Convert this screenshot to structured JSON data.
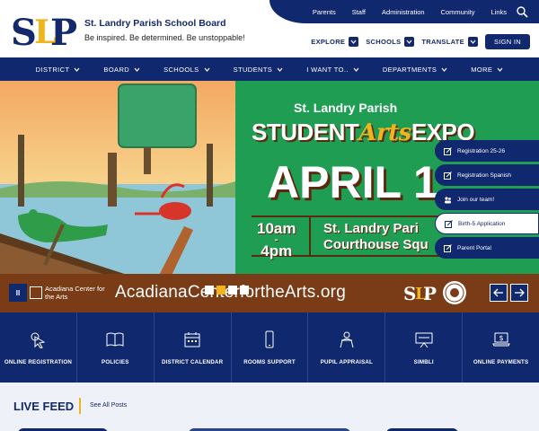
{
  "header": {
    "title": "St. Landry Parish School Board",
    "tagline": "Be inspired. Be determined. Be unstoppable!"
  },
  "util_links": [
    "Parents",
    "Staff",
    "Administration",
    "Community",
    "Links"
  ],
  "quick_menus": {
    "explore": "EXPLORE",
    "schools": "SCHOOLS",
    "translate": "TRANSLATE",
    "signin": "SIGN IN"
  },
  "nav": [
    "DISTRICT",
    "BOARD",
    "SCHOOLS",
    "STUDENTS",
    "I WANT TO..",
    "DEPARTMENTS",
    "MORE"
  ],
  "hero": {
    "line1": "St. Landry Parish",
    "line2_a": "STUDENT",
    "line2_b": "Arts",
    "line2_c": "EXPO",
    "date": "APRIL 1",
    "time_a": "10am",
    "time_dash": "-",
    "time_b": "4pm",
    "venue_a": "St. Landry Pari",
    "venue_b": "Courthouse Squ"
  },
  "side_panel": [
    {
      "label": "Registration 25-26",
      "active": false
    },
    {
      "label": "Registration Spanish",
      "active": false
    },
    {
      "label": "Join our team!",
      "active": false
    },
    {
      "label": "Birth-5 Application",
      "active": true
    },
    {
      "label": "Parent Portal",
      "active": false
    }
  ],
  "banner": {
    "pause": "II",
    "org": "Acadiana Center for the Arts",
    "url": "AcadianaCenterfortheArts.org"
  },
  "quick_links": [
    {
      "label": "ONLINE REGISTRATION",
      "icon": "pointer-icon"
    },
    {
      "label": "POLICIES",
      "icon": "book-icon"
    },
    {
      "label": "DISTRICT CALENDAR",
      "icon": "calendar-icon"
    },
    {
      "label": "ROOMS SUPPORT",
      "icon": "phone-icon"
    },
    {
      "label": "PUPIL APPRAISAL",
      "icon": "person-icon"
    },
    {
      "label": "SIMBLI",
      "icon": "presentation-icon"
    },
    {
      "label": "ONLINE PAYMENTS",
      "icon": "laptop-dollar-icon"
    }
  ],
  "feed": {
    "title": "LIVE FEED",
    "link": "See All Posts"
  },
  "colors": {
    "navy": "#10286e",
    "green": "#1f9d52",
    "brown": "#7a3b17",
    "gold": "#f0b51c"
  }
}
